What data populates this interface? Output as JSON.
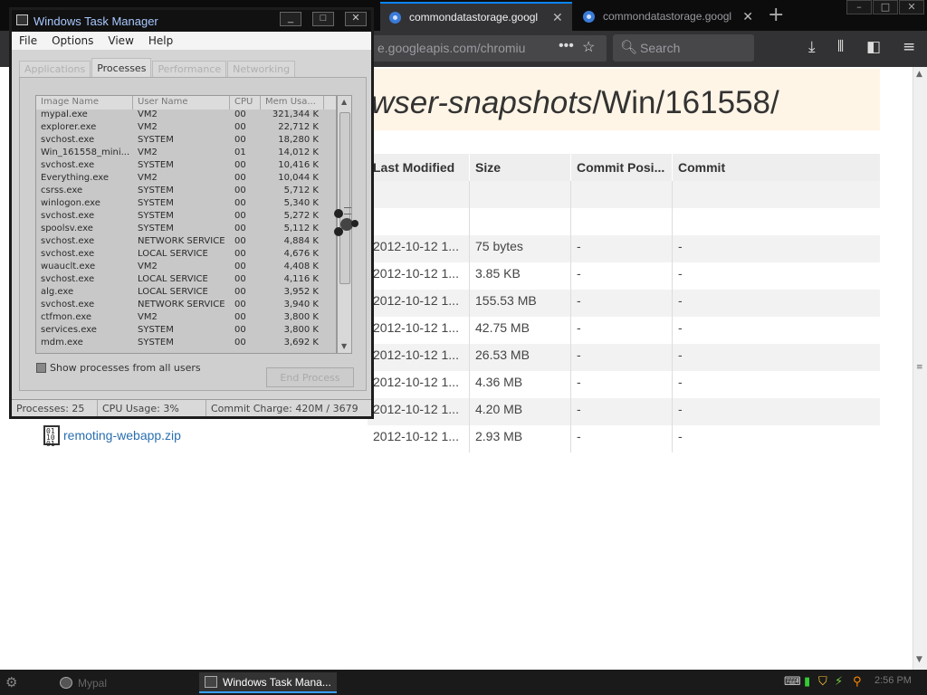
{
  "browser": {
    "tabs": [
      {
        "title": "commondatastorage.googl",
        "active": true
      },
      {
        "title": "commondatastorage.googl",
        "active": false
      }
    ],
    "url": "e.googleapis.com/chromiu",
    "search_placeholder": "Search",
    "icons": [
      "download-icon",
      "library-icon",
      "sidebar-icon",
      "menu-icon"
    ]
  },
  "page": {
    "path_italic": "wser-snapshots",
    "path_rest": "/Win/161558/",
    "columns": [
      "Last Modified",
      "Size",
      "Commit Posi...",
      "Commit"
    ],
    "rows": [
      {
        "modified": "",
        "size": "",
        "pos": "",
        "commit": ""
      },
      {
        "modified": "",
        "size": "",
        "pos": "",
        "commit": ""
      },
      {
        "modified": "2012-10-12 1...",
        "size": "75 bytes",
        "pos": "-",
        "commit": "-"
      },
      {
        "modified": "2012-10-12 1...",
        "size": "3.85 KB",
        "pos": "-",
        "commit": "-"
      },
      {
        "modified": "2012-10-12 1...",
        "size": "155.53 MB",
        "pos": "-",
        "commit": "-"
      },
      {
        "modified": "2012-10-12 1...",
        "size": "42.75 MB",
        "pos": "-",
        "commit": "-"
      },
      {
        "modified": "2012-10-12 1...",
        "size": "26.53 MB",
        "pos": "-",
        "commit": "-"
      },
      {
        "modified": "2012-10-12 1...",
        "size": "4.36 MB",
        "pos": "-",
        "commit": "-"
      },
      {
        "modified": "2012-10-12 1...",
        "size": "4.20 MB",
        "pos": "-",
        "commit": "-"
      },
      {
        "modified": "2012-10-12 1...",
        "size": "2.93 MB",
        "pos": "-",
        "commit": "-"
      }
    ],
    "visible_file": "remoting-webapp.zip"
  },
  "taskmanager": {
    "title": "Windows Task Manager",
    "menu": [
      "File",
      "Options",
      "View",
      "Help"
    ],
    "tabs": [
      "Applications",
      "Processes",
      "Performance",
      "Networking"
    ],
    "active_tab": "Processes",
    "columns": [
      "Image Name",
      "User Name",
      "CPU",
      "Mem Usa..."
    ],
    "processes": [
      {
        "name": "mypal.exe",
        "user": "VM2",
        "cpu": "00",
        "mem": "321,344 K"
      },
      {
        "name": "explorer.exe",
        "user": "VM2",
        "cpu": "00",
        "mem": "22,712 K"
      },
      {
        "name": "svchost.exe",
        "user": "SYSTEM",
        "cpu": "00",
        "mem": "18,280 K"
      },
      {
        "name": "Win_161558_mini...",
        "user": "VM2",
        "cpu": "01",
        "mem": "14,012 K"
      },
      {
        "name": "svchost.exe",
        "user": "SYSTEM",
        "cpu": "00",
        "mem": "10,416 K"
      },
      {
        "name": "Everything.exe",
        "user": "VM2",
        "cpu": "00",
        "mem": "10,044 K"
      },
      {
        "name": "csrss.exe",
        "user": "SYSTEM",
        "cpu": "00",
        "mem": "5,712 K"
      },
      {
        "name": "winlogon.exe",
        "user": "SYSTEM",
        "cpu": "00",
        "mem": "5,340 K"
      },
      {
        "name": "svchost.exe",
        "user": "SYSTEM",
        "cpu": "00",
        "mem": "5,272 K"
      },
      {
        "name": "spoolsv.exe",
        "user": "SYSTEM",
        "cpu": "00",
        "mem": "5,112 K"
      },
      {
        "name": "svchost.exe",
        "user": "NETWORK SERVICE",
        "cpu": "00",
        "mem": "4,884 K"
      },
      {
        "name": "svchost.exe",
        "user": "LOCAL SERVICE",
        "cpu": "00",
        "mem": "4,676 K"
      },
      {
        "name": "wuauclt.exe",
        "user": "VM2",
        "cpu": "00",
        "mem": "4,408 K"
      },
      {
        "name": "svchost.exe",
        "user": "LOCAL SERVICE",
        "cpu": "00",
        "mem": "4,116 K"
      },
      {
        "name": "alg.exe",
        "user": "LOCAL SERVICE",
        "cpu": "00",
        "mem": "3,952 K"
      },
      {
        "name": "svchost.exe",
        "user": "NETWORK SERVICE",
        "cpu": "00",
        "mem": "3,940 K"
      },
      {
        "name": "ctfmon.exe",
        "user": "VM2",
        "cpu": "00",
        "mem": "3,800 K"
      },
      {
        "name": "services.exe",
        "user": "SYSTEM",
        "cpu": "00",
        "mem": "3,800 K"
      },
      {
        "name": "mdm.exe",
        "user": "SYSTEM",
        "cpu": "00",
        "mem": "3,692 K"
      }
    ],
    "show_all_label": "Show processes from all users",
    "end_process_label": "End Process",
    "status": {
      "processes": "Processes: 25",
      "cpu": "CPU Usage: 3%",
      "commit": "Commit Charge: 420M / 3679"
    }
  },
  "taskbar": {
    "tasks": [
      {
        "label": "Mypal",
        "active": false
      },
      {
        "label": "Windows Task Mana...",
        "active": true
      }
    ],
    "clock": "2:56 PM"
  }
}
